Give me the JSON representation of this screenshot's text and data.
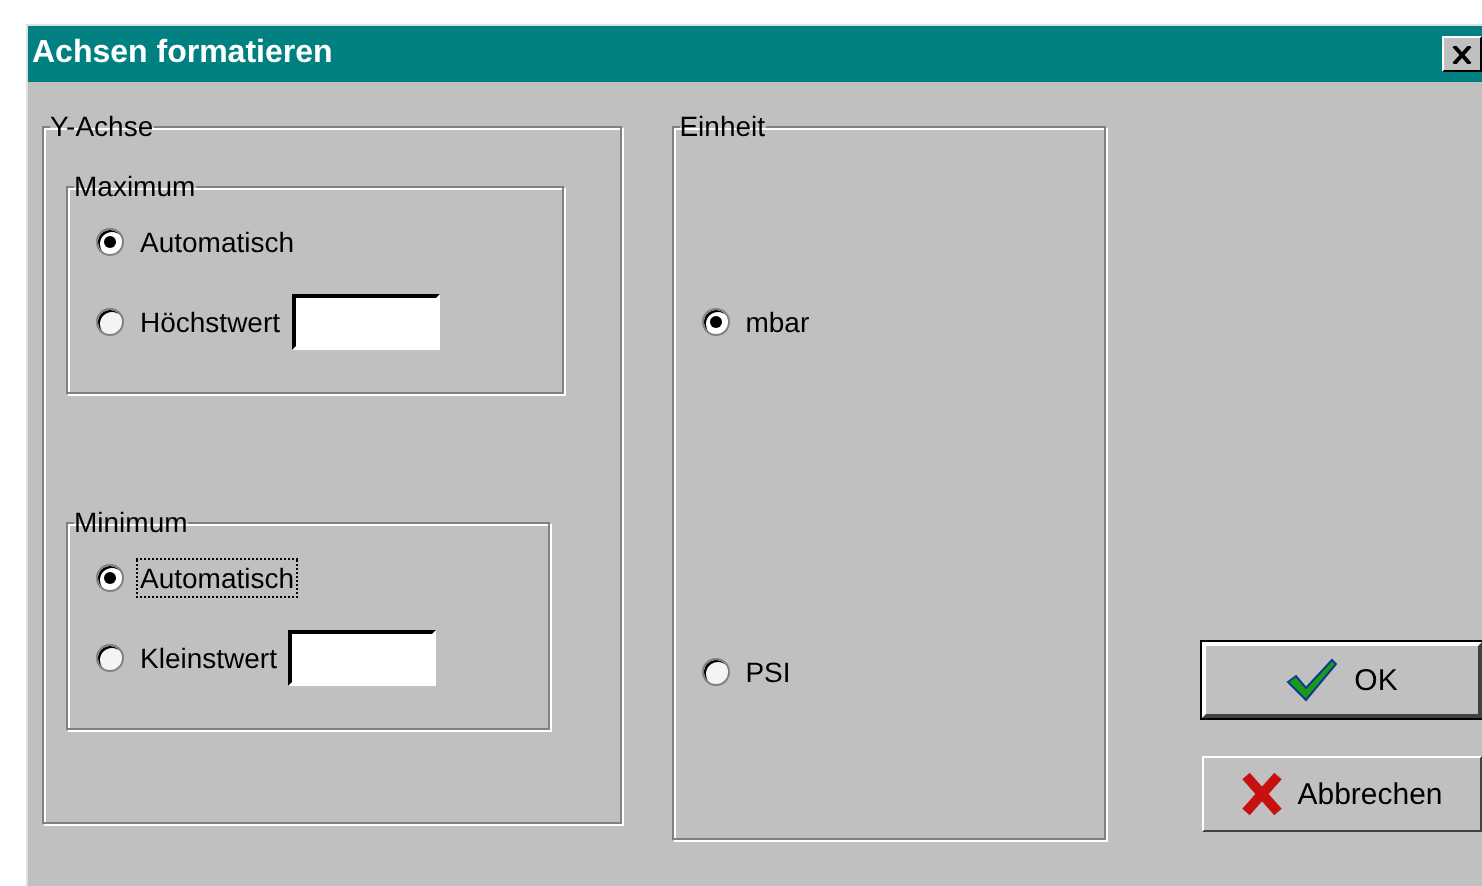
{
  "window": {
    "title": "Achsen formatieren"
  },
  "y_axis": {
    "label": "Y-Achse",
    "groups": [
      {
        "label": "Maximum",
        "options": [
          {
            "label": "Automatisch",
            "selected": true,
            "focused": false,
            "kind": "plain"
          },
          {
            "label": "Höchstwert",
            "selected": false,
            "focused": false,
            "kind": "field"
          }
        ]
      },
      {
        "label": "Minimum",
        "options": [
          {
            "label": "Automatisch",
            "selected": true,
            "focused": true,
            "kind": "plain"
          },
          {
            "label": "Kleinstwert",
            "selected": false,
            "focused": false,
            "kind": "field"
          }
        ]
      }
    ]
  },
  "unit": {
    "label": "Einheit",
    "options": [
      {
        "label": "mbar",
        "selected": true
      },
      {
        "label": "PSI",
        "selected": false
      }
    ]
  },
  "buttons": [
    {
      "label": "OK",
      "kind": "ok",
      "default": true
    },
    {
      "label": "Abbrechen",
      "kind": "cancel",
      "default": false
    }
  ]
}
